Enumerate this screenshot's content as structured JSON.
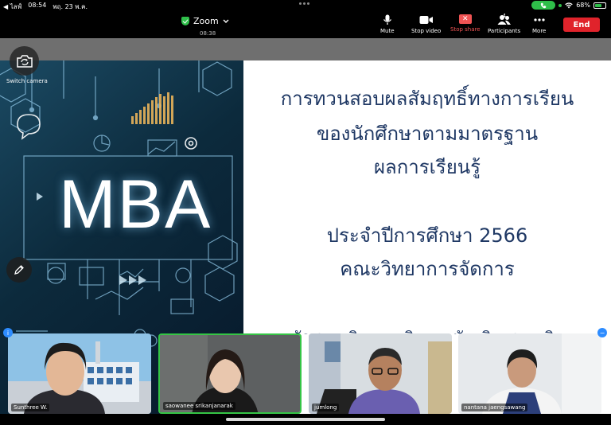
{
  "status_bar": {
    "back_label": "◀ ไลฟ์",
    "time": "08:54",
    "date": "พฤ. 23 พ.ค.",
    "wifi_icon": "wifi-icon",
    "battery_percent": "68%",
    "battery_level": 0.68,
    "call_icon": "phone-icon"
  },
  "toolbar": {
    "app_title": "Zoom",
    "timer": "08:38",
    "mute_label": "Mute",
    "stop_video_label": "Stop video",
    "stop_share_label": "Stop share",
    "participants_label": "Participants",
    "participants_count": "4",
    "more_label": "More",
    "end_label": "End"
  },
  "side_controls": {
    "switch_camera_label": "Switch camera"
  },
  "slide": {
    "image_text": "MBA",
    "line1": "การทวนสอบผลสัมฤทธิ์ทางการเรียน",
    "line2": "ของนักศึกษาตามมาตรฐาน",
    "line3": "ผลการเรียนรู้",
    "line4": "ประจำปีการศึกษา 2566",
    "line5": "คณะวิทยาการจัดการ",
    "line6": "หลักสูตรบริหารธุรกิจมหาบัณฑิต สาขาวิชาบริหารธุรกิจ"
  },
  "participants": [
    {
      "name": "Sunthree W."
    },
    {
      "name": "saowanee srikanjanarak"
    },
    {
      "name": "jumlong"
    },
    {
      "name": "nantana jaengsawang"
    }
  ],
  "colors": {
    "end_button": "#e0232b",
    "active_speaker": "#35c545",
    "slide_text": "#1f3864",
    "stop_share": "#f05454"
  }
}
